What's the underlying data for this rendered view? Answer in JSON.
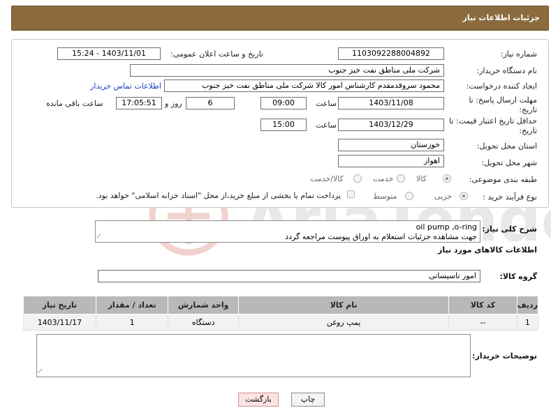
{
  "header": {
    "title": "جزئیات اطلاعات نیاز"
  },
  "form": {
    "need_number": {
      "label": "شماره نیاز:",
      "value": "1103092288004892"
    },
    "announce_datetime": {
      "label": "تاریخ و ساعت اعلان عمومی:",
      "value": "1403/11/01 - 15:24"
    },
    "buyer_org": {
      "label": "نام دستگاه خریدار:",
      "value": "شرکت ملی مناطق نفت خیز جنوب"
    },
    "requester": {
      "label": "ایجاد کننده درخواست:",
      "value": "محمود سروقدمقدم کارشناس امور کالا شرکت ملی مناطق نفت خیز جنوب",
      "contact_link": "اطلاعات تماس خریدار"
    },
    "reply_deadline": {
      "label": "مهلت ارسال پاسخ: تا تاریخ:",
      "date": "1403/11/08",
      "time_label": "ساعت",
      "time": "09:00",
      "days": "6",
      "days_label": "روز و",
      "remaining": "17:05:51",
      "remaining_label": "ساعت باقی مانده"
    },
    "price_validity": {
      "label": "حداقل تاریخ اعتبار قیمت: تا تاریخ:",
      "date": "1403/12/29",
      "time_label": "ساعت",
      "time": "15:00"
    },
    "province": {
      "label": "استان محل تحویل:",
      "value": "خوزستان"
    },
    "city": {
      "label": "شهر محل تحویل:",
      "value": "اهواز"
    },
    "category": {
      "label": "طبقه بندی موضوعی:",
      "options": [
        "کالا",
        "خدمت",
        "کالا/خدمت"
      ],
      "selected": 0
    },
    "purchase_process": {
      "label": "نوع فرآیند خرید :",
      "options": [
        "جزیی",
        "متوسط"
      ],
      "selected": 0,
      "payment_note": "پرداخت تمام یا بخشی از مبلغ خرید،از محل \"اسناد خزانه اسلامی\" خواهد بود."
    }
  },
  "general_description": {
    "label": "شرح کلی نیاز:",
    "line1": "oil pump ,o-ring",
    "line2": "جهت مشاهده جزئیات استعلام به اوراق پیوست مراجعه گردد"
  },
  "goods_section": {
    "title": "اطلاعات کالاهای مورد نیاز"
  },
  "goods_group": {
    "label": "گروه کالا:",
    "value": "امور تاسیساتی"
  },
  "table": {
    "columns": [
      "ردیف",
      "کد کالا",
      "نام کالا",
      "واحد شمارش",
      "تعداد / مقدار",
      "تاریخ نیاز"
    ],
    "rows": [
      [
        "1",
        "--",
        "پمپ روغن",
        "دستگاه",
        "1",
        "1403/11/17"
      ]
    ]
  },
  "buyer_notes": {
    "label": "توضیحات خریدار:",
    "value": ""
  },
  "buttons": {
    "print": "چاپ",
    "back": "بازگشت"
  },
  "watermark": {
    "text": "AriaTender.neT"
  }
}
